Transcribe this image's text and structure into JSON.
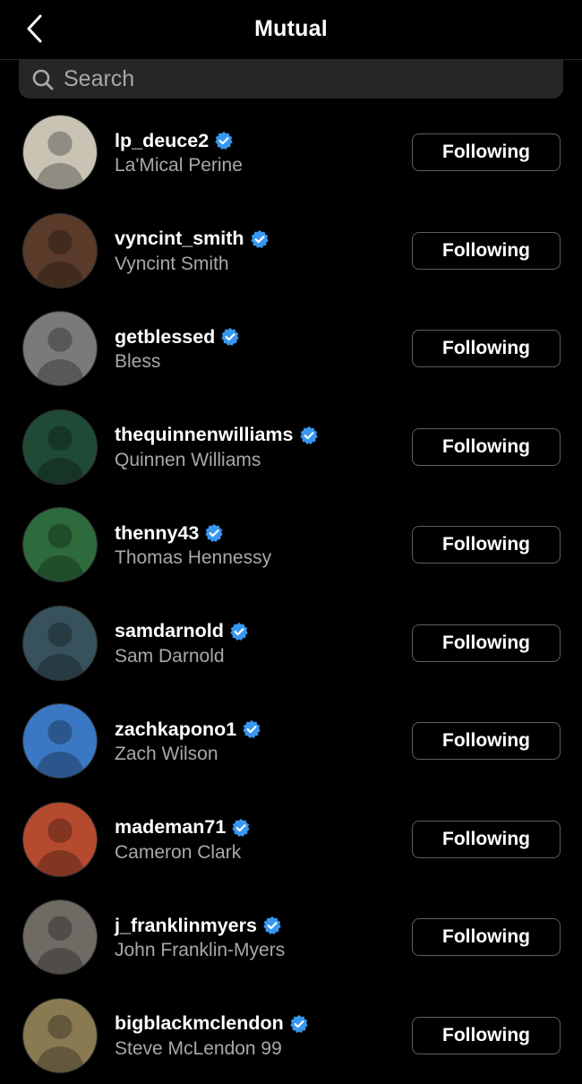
{
  "header": {
    "title": "Mutual",
    "back_icon": "chevron-left-icon"
  },
  "search": {
    "placeholder": "Search",
    "value": ""
  },
  "accent_color": "#3897f0",
  "users": [
    {
      "username": "lp_deuce2",
      "full_name": "La'Mical Perine",
      "button": "Following",
      "verified": true,
      "avatar_color": "#c9c3b4"
    },
    {
      "username": "vyncint_smith",
      "full_name": "Vyncint Smith",
      "button": "Following",
      "verified": true,
      "avatar_color": "#5a3b2a"
    },
    {
      "username": "getblessed",
      "full_name": "Bless",
      "button": "Following",
      "verified": true,
      "avatar_color": "#7a7a7a"
    },
    {
      "username": "thequinnenwilliams",
      "full_name": "Quinnen Williams",
      "button": "Following",
      "verified": true,
      "avatar_color": "#1f4a35"
    },
    {
      "username": "thenny43",
      "full_name": "Thomas Hennessy",
      "button": "Following",
      "verified": true,
      "avatar_color": "#2e6b3c"
    },
    {
      "username": "samdarnold",
      "full_name": "Sam Darnold",
      "button": "Following",
      "verified": true,
      "avatar_color": "#37525c"
    },
    {
      "username": "zachkapono1",
      "full_name": "Zach Wilson",
      "button": "Following",
      "verified": true,
      "avatar_color": "#3b78c4"
    },
    {
      "username": "mademan71",
      "full_name": "Cameron Clark",
      "button": "Following",
      "verified": true,
      "avatar_color": "#b54a2e"
    },
    {
      "username": "j_franklinmyers",
      "full_name": "John Franklin-Myers",
      "button": "Following",
      "verified": true,
      "avatar_color": "#6f6a63"
    },
    {
      "username": "bigblackmclendon",
      "full_name": "Steve McLendon 99",
      "button": "Following",
      "verified": true,
      "avatar_color": "#8a7a52"
    }
  ]
}
